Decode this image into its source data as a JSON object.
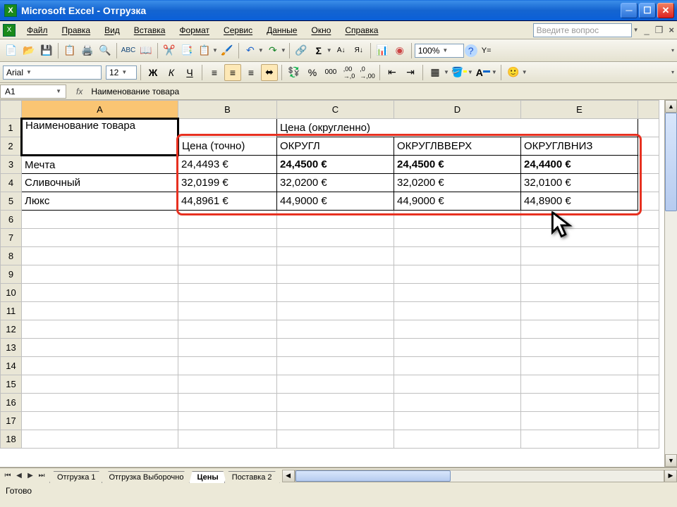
{
  "title": "Microsoft Excel - Отгрузка",
  "menu": {
    "file": "Файл",
    "edit": "Правка",
    "view": "Вид",
    "insert": "Вставка",
    "format": "Формат",
    "tools": "Сервис",
    "data": "Данные",
    "window": "Окно",
    "help": "Справка",
    "help_placeholder": "Введите вопрос"
  },
  "winctl": {
    "min": "_",
    "restore": "❐",
    "close": "×"
  },
  "toolbar": {
    "zoom": "100%",
    "font": "Arial",
    "size": "12",
    "bold": "Ж",
    "italic": "К",
    "underline": "Ч"
  },
  "fbar": {
    "cell": "A1",
    "fx": "fx",
    "formula": "Наименование товара"
  },
  "cols": [
    "A",
    "B",
    "C",
    "D",
    "E"
  ],
  "rows_hdr": [
    "1",
    "2",
    "3",
    "4",
    "5",
    "6",
    "7",
    "8",
    "9",
    "10",
    "11",
    "12",
    "13",
    "14",
    "15",
    "16",
    "17",
    "18"
  ],
  "data": {
    "A1": "Наименование товара",
    "BE1": "Цена (округленно)",
    "B2": "Цена (точно)",
    "C2": "ОКРУГЛ",
    "D2": "ОКРУГЛВВЕРХ",
    "E2": "ОКРУГЛВНИЗ",
    "A3": "Мечта",
    "B3": "24,4493 €",
    "C3": "24,4500 €",
    "D3": "24,4500 €",
    "E3": "24,4400 €",
    "A4": "Сливочный",
    "B4": "32,0199 €",
    "C4": "32,0200 €",
    "D4": "32,0200 €",
    "E4": "32,0100 €",
    "A5": "Люкс",
    "B5": "44,8961 €",
    "C5": "44,9000 €",
    "D5": "44,9000 €",
    "E5": "44,8900 €"
  },
  "tabs": {
    "t1": "Отгрузка 1",
    "t2": "Отгрузка Выборочно",
    "t3": "Цены",
    "t4": "Поставка 2"
  },
  "status": "Готово"
}
